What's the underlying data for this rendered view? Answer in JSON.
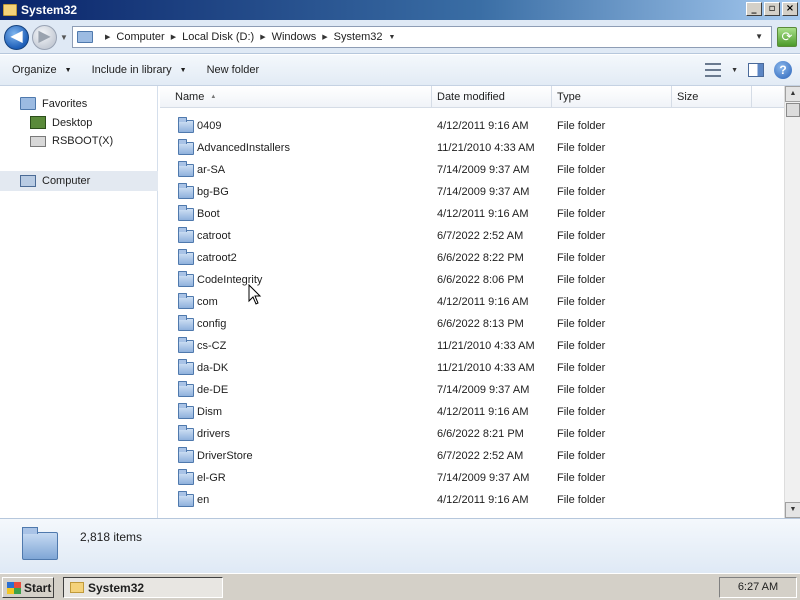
{
  "window": {
    "title": "System32",
    "controls": {
      "minimize": "_",
      "maximize": "▫",
      "close": "×"
    }
  },
  "address": {
    "breadcrumbs": [
      "Computer",
      "Local Disk (D:)",
      "Windows",
      "System32"
    ]
  },
  "toolbar": {
    "organize": "Organize",
    "include_in_library": "Include in library",
    "new_folder": "New folder"
  },
  "navigation": {
    "favorites": "Favorites",
    "desktop": "Desktop",
    "rsboot": "RSBOOT(X)",
    "computer": "Computer"
  },
  "columns": {
    "name": "Name",
    "date_modified": "Date modified",
    "type": "Type",
    "size": "Size"
  },
  "files": [
    {
      "name": "0409",
      "date": "4/12/2011 9:16 AM",
      "type": "File folder"
    },
    {
      "name": "AdvancedInstallers",
      "date": "11/21/2010 4:33 AM",
      "type": "File folder"
    },
    {
      "name": "ar-SA",
      "date": "7/14/2009 9:37 AM",
      "type": "File folder"
    },
    {
      "name": "bg-BG",
      "date": "7/14/2009 9:37 AM",
      "type": "File folder"
    },
    {
      "name": "Boot",
      "date": "4/12/2011 9:16 AM",
      "type": "File folder"
    },
    {
      "name": "catroot",
      "date": "6/7/2022 2:52 AM",
      "type": "File folder"
    },
    {
      "name": "catroot2",
      "date": "6/6/2022 8:22 PM",
      "type": "File folder"
    },
    {
      "name": "CodeIntegrity",
      "date": "6/6/2022 8:06 PM",
      "type": "File folder"
    },
    {
      "name": "com",
      "date": "4/12/2011 9:16 AM",
      "type": "File folder"
    },
    {
      "name": "config",
      "date": "6/6/2022 8:13 PM",
      "type": "File folder"
    },
    {
      "name": "cs-CZ",
      "date": "11/21/2010 4:33 AM",
      "type": "File folder"
    },
    {
      "name": "da-DK",
      "date": "11/21/2010 4:33 AM",
      "type": "File folder"
    },
    {
      "name": "de-DE",
      "date": "7/14/2009 9:37 AM",
      "type": "File folder"
    },
    {
      "name": "Dism",
      "date": "4/12/2011 9:16 AM",
      "type": "File folder"
    },
    {
      "name": "drivers",
      "date": "6/6/2022 8:21 PM",
      "type": "File folder"
    },
    {
      "name": "DriverStore",
      "date": "6/7/2022 2:52 AM",
      "type": "File folder"
    },
    {
      "name": "el-GR",
      "date": "7/14/2009 9:37 AM",
      "type": "File folder"
    },
    {
      "name": "en",
      "date": "4/12/2011 9:16 AM",
      "type": "File folder"
    }
  ],
  "details": {
    "item_count": "2,818 items"
  },
  "taskbar": {
    "start": "Start",
    "task": "System32",
    "clock": "6:27 AM"
  }
}
